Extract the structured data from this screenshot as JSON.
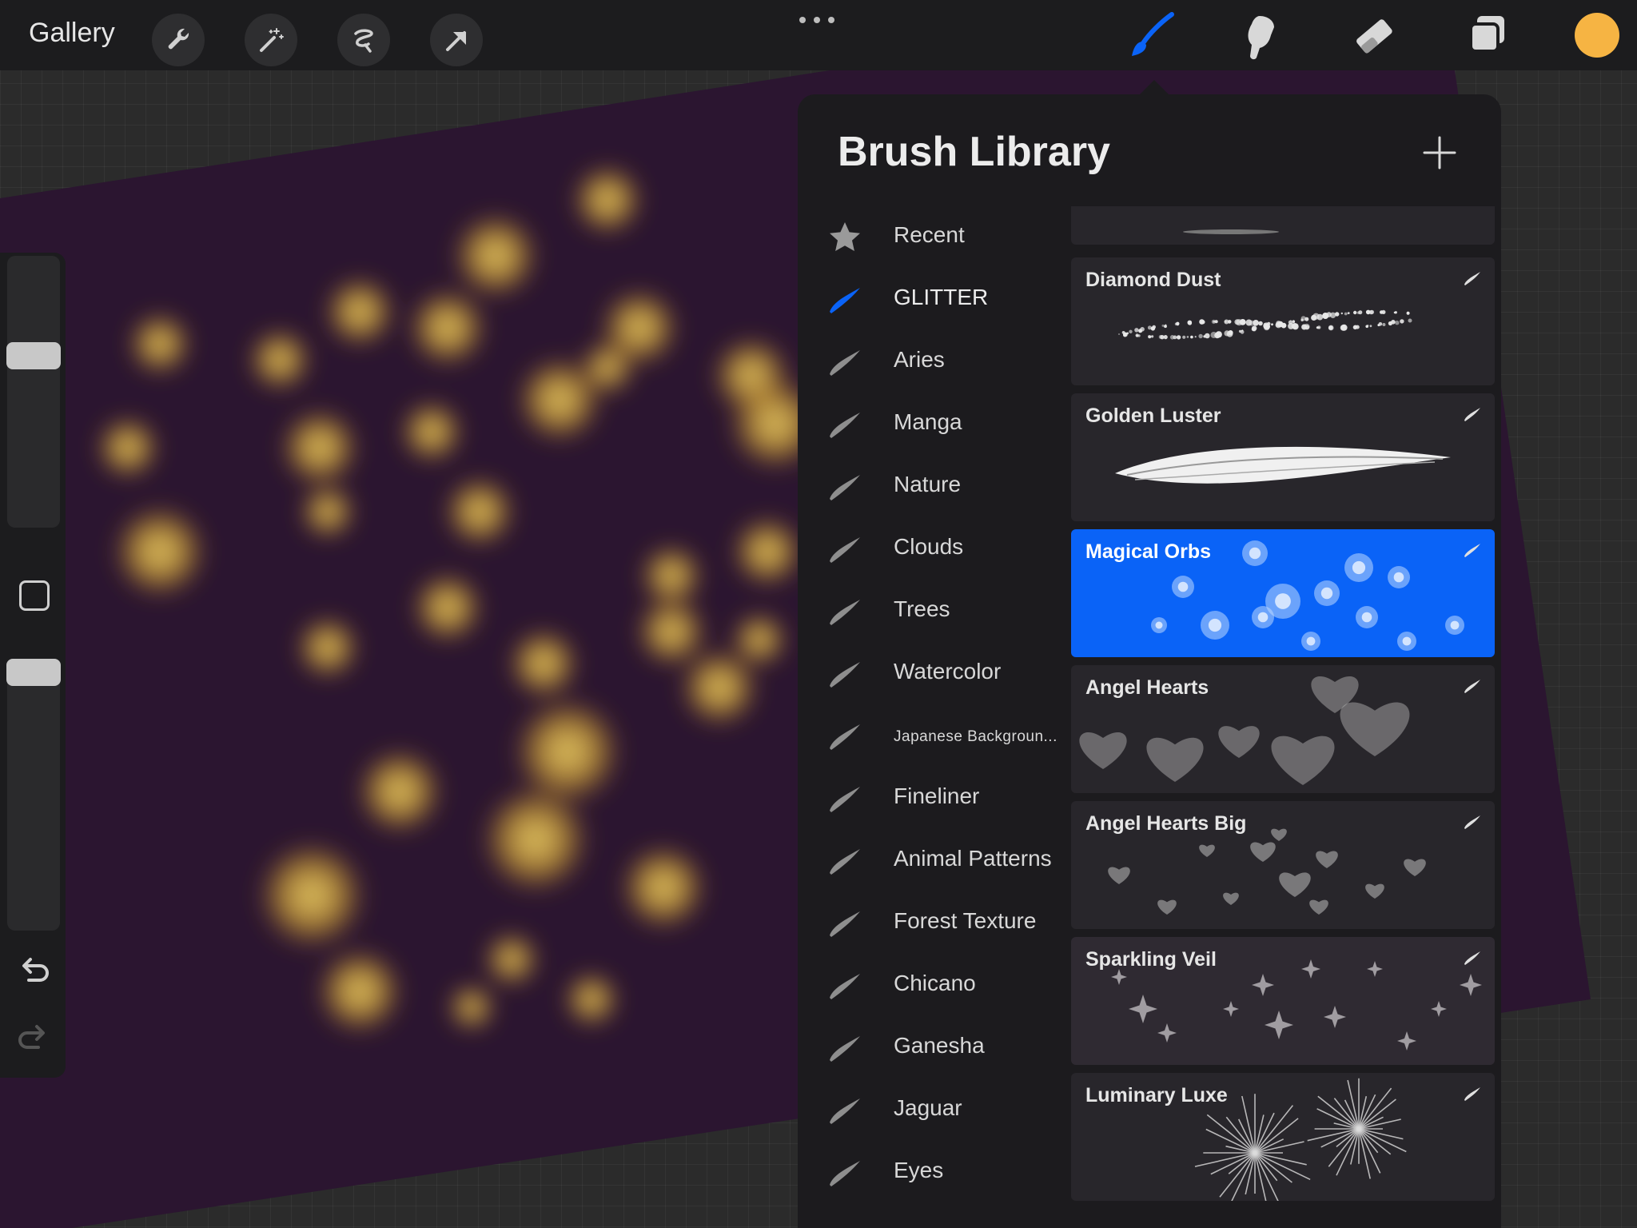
{
  "toolbar": {
    "gallery_label": "Gallery",
    "left_tools": [
      "wrench-icon",
      "magic-wand-icon",
      "selection-icon",
      "transform-arrow-icon"
    ],
    "right_tools": [
      "brush-icon",
      "smudge-icon",
      "eraser-icon",
      "layers-icon"
    ],
    "active_tool": "brush-icon",
    "current_color": "#f6b443"
  },
  "panel": {
    "title": "Brush Library"
  },
  "brush_sets": [
    {
      "label": "Recent",
      "icon": "star-icon"
    },
    {
      "label": "GLITTER",
      "icon": "brush-stroke-icon",
      "active": true
    },
    {
      "label": "Aries",
      "icon": "brush-stroke-icon"
    },
    {
      "label": "Manga",
      "icon": "brush-stroke-icon"
    },
    {
      "label": "Nature",
      "icon": "brush-stroke-icon"
    },
    {
      "label": "Clouds",
      "icon": "brush-stroke-icon"
    },
    {
      "label": "Trees",
      "icon": "brush-stroke-icon"
    },
    {
      "label": "Watercolor",
      "icon": "brush-stroke-icon"
    },
    {
      "label": "Japanese Backgroun...",
      "icon": "brush-stroke-icon"
    },
    {
      "label": "Fineliner",
      "icon": "brush-stroke-icon"
    },
    {
      "label": "Animal Patterns",
      "icon": "brush-stroke-icon"
    },
    {
      "label": "Forest Texture",
      "icon": "brush-stroke-icon"
    },
    {
      "label": "Chicano",
      "icon": "brush-stroke-icon"
    },
    {
      "label": "Ganesha",
      "icon": "brush-stroke-icon"
    },
    {
      "label": "Jaguar",
      "icon": "brush-stroke-icon"
    },
    {
      "label": "Eyes",
      "icon": "brush-stroke-icon"
    }
  ],
  "brushes": [
    {
      "name": "Diamond Dust",
      "preview": "sparkle-line"
    },
    {
      "name": "Golden Luster",
      "preview": "feather-stroke"
    },
    {
      "name": "Magical Orbs",
      "preview": "orbs",
      "selected": true
    },
    {
      "name": "Angel Hearts",
      "preview": "hearts"
    },
    {
      "name": "Angel Hearts Big",
      "preview": "hearts-big"
    },
    {
      "name": "Sparkling Veil",
      "preview": "stars"
    },
    {
      "name": "Luminary Luxe",
      "preview": "bursts"
    }
  ],
  "colors": {
    "accent": "#0a63f7",
    "canvas": "#2b1530",
    "glow": "#e3b84a"
  }
}
